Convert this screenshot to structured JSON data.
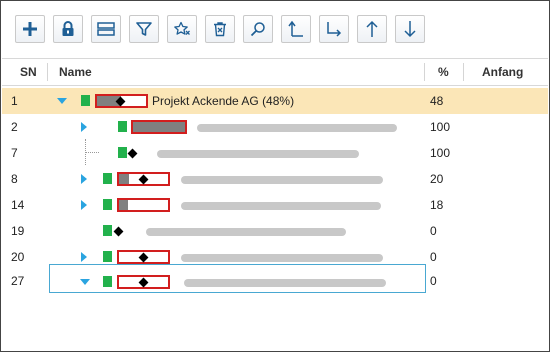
{
  "toolbar": {
    "buttons": [
      {
        "name": "add-button",
        "icon": "plus-icon"
      },
      {
        "name": "lock-button",
        "icon": "lock-icon"
      },
      {
        "name": "layout-button",
        "icon": "rows-icon"
      },
      {
        "name": "filter-button",
        "icon": "filter-icon"
      },
      {
        "name": "favorite-button",
        "icon": "star-icon"
      },
      {
        "name": "delete-button",
        "icon": "trash-icon"
      },
      {
        "name": "search-button",
        "icon": "search-icon"
      },
      {
        "name": "outdent-button",
        "icon": "arrow-up-left-icon"
      },
      {
        "name": "indent-button",
        "icon": "arrow-down-right-icon"
      },
      {
        "name": "move-up-button",
        "icon": "arrow-up-icon"
      },
      {
        "name": "move-down-button",
        "icon": "arrow-down-icon"
      }
    ]
  },
  "columns": {
    "sn": "SN",
    "name": "Name",
    "pct": "%",
    "start": "Anfang"
  },
  "rows": [
    {
      "sn": "1",
      "pct": "48",
      "label": "Projekt Ackende AG (48%)",
      "progress": 0.48,
      "selected": true
    },
    {
      "sn": "2",
      "pct": "100",
      "progress": 1.0
    },
    {
      "sn": "7",
      "pct": "100",
      "progress": 1.0
    },
    {
      "sn": "8",
      "pct": "20",
      "progress": 0.2
    },
    {
      "sn": "14",
      "pct": "18",
      "progress": 0.18
    },
    {
      "sn": "19",
      "pct": "0",
      "progress": 0
    },
    {
      "sn": "20",
      "pct": "0",
      "progress": 0
    },
    {
      "sn": "27",
      "pct": "0",
      "progress": 0,
      "focused": true
    }
  ],
  "colors": {
    "selected_row": "#fbe6b7",
    "accent": "#2aa4e0",
    "bar_border": "#d21e1e",
    "milestone": "#22b14c"
  }
}
